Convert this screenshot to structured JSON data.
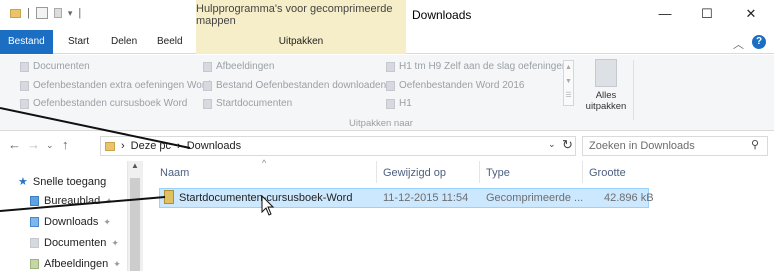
{
  "titlebar": {
    "contextual_tools": "Hulpprogramma's voor gecomprimeerde mappen",
    "title": "Downloads",
    "minimize": "—",
    "maximize": "☐",
    "close": "✕"
  },
  "tabs": {
    "file": "Bestand",
    "start": "Start",
    "share": "Delen",
    "view": "Beeld",
    "extract": "Uitpakken"
  },
  "ribbon": {
    "col1": [
      "Documenten",
      "Oefenbestanden extra oefeningen Word",
      "Oefenbestanden cursusboek Word"
    ],
    "col2": [
      "Afbeeldingen",
      "Bestand Oefenbestanden downloaden",
      "Startdocumenten"
    ],
    "col3": [
      "H1 tm H9 Zelf aan de slag oefeningen",
      "Oefenbestanden Word 2016",
      "H1"
    ],
    "group_label": "Uitpakken naar",
    "extract_all": "Alles uitpakken"
  },
  "address": {
    "crumbs": [
      "Deze pc",
      "Downloads"
    ],
    "search_placeholder": "Zoeken in Downloads"
  },
  "navpane": {
    "quick_access": "Snelle toegang",
    "items": [
      "Bureaublad",
      "Downloads",
      "Documenten",
      "Afbeeldingen"
    ]
  },
  "filelist": {
    "columns": [
      "Naam",
      "Gewijzigd op",
      "Type",
      "Grootte"
    ],
    "rows": [
      {
        "name": "Startdocumenten-cursusboek-Word",
        "modified": "11-12-2015 11:54",
        "type": "Gecomprimeerde ...",
        "size": "42.896 kB"
      }
    ]
  }
}
